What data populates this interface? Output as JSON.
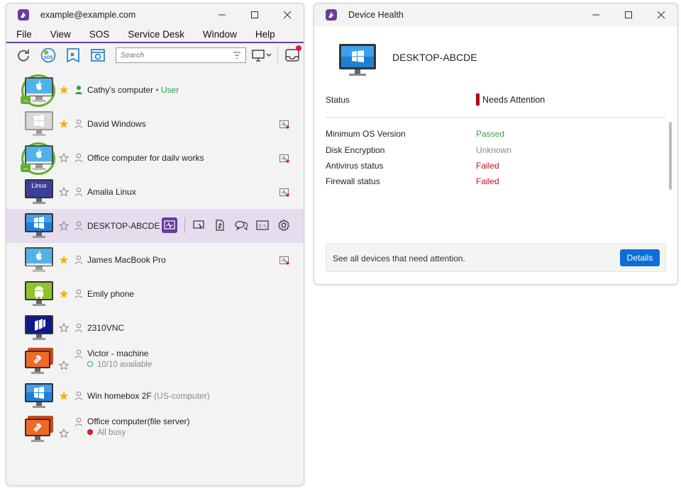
{
  "left_window": {
    "title": "example@example.com",
    "menu": [
      "File",
      "View",
      "SOS",
      "Service Desk",
      "Window",
      "Help"
    ],
    "search": {
      "placeholder": "Search"
    },
    "devices": [
      {
        "name": "Cathy's computer",
        "suffix": " • User",
        "suffix_style": "green",
        "icon": "mac-icon",
        "starred": true,
        "ring": true,
        "health": false
      },
      {
        "name": "David Windows",
        "icon": "windows-grey-icon",
        "starred": true,
        "ring": false,
        "health": true
      },
      {
        "name": "Office computer for dailv works",
        "icon": "mac-icon",
        "starred": false,
        "ring": true,
        "health": true
      },
      {
        "name": "Amalia Linux",
        "icon": "linux-icon",
        "starred": false,
        "ring": false,
        "health": true
      },
      {
        "name": "DESKTOP-ABCDE",
        "icon": "windows-icon",
        "starred": false,
        "selected": true
      },
      {
        "name": "James MacBook Pro",
        "icon": "mac-icon",
        "starred": true,
        "health": true
      },
      {
        "name": "Emily phone",
        "icon": "android-icon",
        "starred": true
      },
      {
        "name": "2310VNC",
        "icon": "vnc-icon",
        "starred": false
      },
      {
        "name": "Victor - machine",
        "sub": "10/10 available",
        "sub_status": "available",
        "icon": "remote-group-icon",
        "starred": false
      },
      {
        "name": "Win homebox 2F",
        "suffix": " (US-computer)",
        "suffix_style": "dim",
        "icon": "windows-icon",
        "starred": true
      },
      {
        "name": "Office computer(file server)",
        "sub": "All busy",
        "sub_status": "busy",
        "icon": "remote-group-icon",
        "starred": false
      }
    ]
  },
  "right_window": {
    "title": "Device Health",
    "device_name": "DESKTOP-ABCDE",
    "status_label": "Status",
    "status_value": "Needs Attention",
    "checks": [
      {
        "label": "Minimum OS Version",
        "value": "Passed",
        "state": "pass"
      },
      {
        "label": "Disk Encryption",
        "value": "Unknown",
        "state": "unknown"
      },
      {
        "label": "Antivirus status",
        "value": "Failed",
        "state": "fail"
      },
      {
        "label": "Firewall status",
        "value": "Failed",
        "state": "fail"
      }
    ],
    "banner_text": "See all devices that need attention.",
    "details_label": "Details"
  },
  "colors": {
    "brand": "#6a3d9a",
    "accent_blue": "#0a6fd8",
    "online_green": "#63b02e",
    "fail_red": "#c1121f",
    "pass_green": "#3aa14a"
  }
}
